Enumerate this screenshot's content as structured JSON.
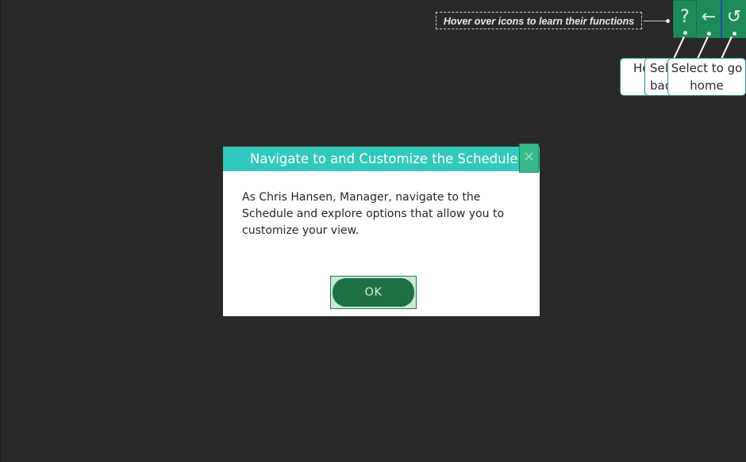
{
  "toolbar": {
    "hint_text": "Hover over icons to learn their functions",
    "help_glyph": "?",
    "back_glyph": "←",
    "home_glyph": "↺",
    "icons": [
      "help-icon",
      "back-arrow-icon",
      "home-icon"
    ]
  },
  "tooltips": {
    "help": "Help view",
    "back": "Select to go back",
    "home": "Select to go home"
  },
  "modal": {
    "title": "Navigate to and Customize the Schedule",
    "close_glyph": "✕",
    "body": "As Chris Hansen, Manager, navigate to the Schedule and explore options that allow you to customize your view.",
    "ok_label": "OK"
  },
  "colors": {
    "background": "#292929",
    "header_teal": "#32c8bd",
    "toolbar_green": "#1e8a5c",
    "ok_green": "#1e6f46",
    "tooltip_border": "#2a8f8a"
  }
}
